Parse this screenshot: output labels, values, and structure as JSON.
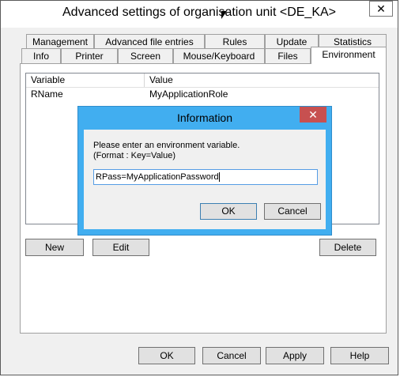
{
  "window": {
    "title": "Advanced settings of organisation unit <DE_KA>",
    "close_glyph": "✕"
  },
  "tabs_row1": [
    "Management",
    "Advanced file entries",
    "Rules",
    "Update",
    "Statistics"
  ],
  "tabs_row2": [
    "Info",
    "Printer",
    "Screen",
    "Mouse/Keyboard",
    "Files",
    "Environment"
  ],
  "active_tab": "Environment",
  "list": {
    "columns": [
      "Variable",
      "Value"
    ],
    "rows": [
      {
        "variable": "RName",
        "value": "MyApplicationRole"
      }
    ]
  },
  "list_buttons": {
    "new": "New",
    "edit": "Edit",
    "delete": "Delete"
  },
  "footer_buttons": {
    "ok": "OK",
    "cancel": "Cancel",
    "apply": "Apply",
    "help": "Help"
  },
  "dialog": {
    "title": "Information",
    "close_glyph": "✕",
    "message_line1": "Please enter an environment variable.",
    "message_line2": "(Format : Key=Value)",
    "input_value": "RPass=MyApplicationPassword",
    "ok": "OK",
    "cancel": "Cancel"
  },
  "colors": {
    "dialog_frame": "#41aef0",
    "dialog_close": "#c75050",
    "input_focus_border": "#569de5"
  }
}
